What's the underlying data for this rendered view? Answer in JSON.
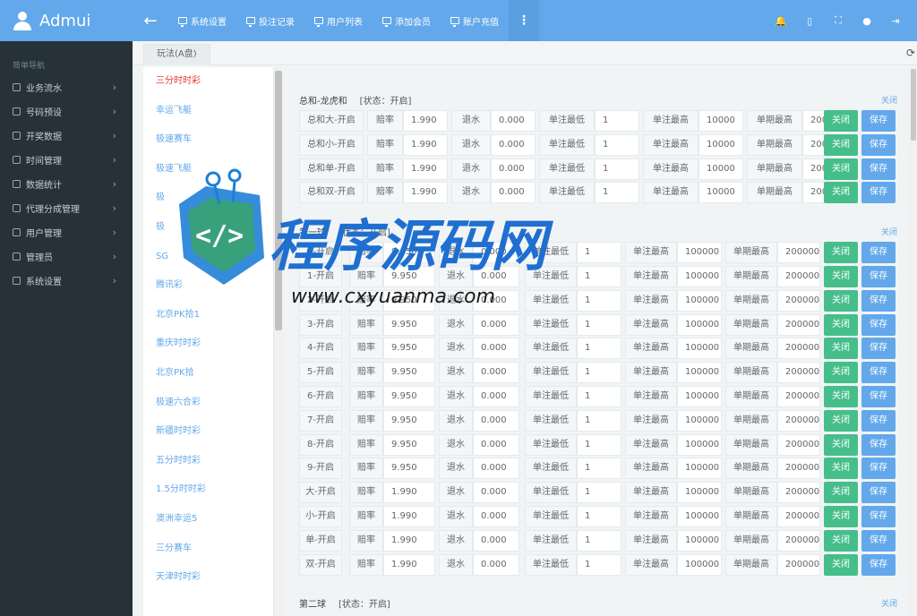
{
  "brand": {
    "name": "Admui"
  },
  "topnav": {
    "back_label": "←",
    "items": [
      {
        "label": "系统设置"
      },
      {
        "label": "投注记录"
      },
      {
        "label": "用户列表"
      },
      {
        "label": "添加会员"
      },
      {
        "label": "账户充值"
      }
    ],
    "more_label": "⋮",
    "right_icons": [
      "bell-icon",
      "document-icon",
      "fullscreen-icon",
      "user-icon",
      "logout-icon"
    ]
  },
  "sidebar": {
    "title": "简单导航",
    "items": [
      {
        "label": "业务流水"
      },
      {
        "label": "号码预设"
      },
      {
        "label": "开奖数据"
      },
      {
        "label": "时间管理"
      },
      {
        "label": "数据统计"
      },
      {
        "label": "代理分成管理"
      },
      {
        "label": "用户管理"
      },
      {
        "label": "管理员"
      },
      {
        "label": "系统设置"
      }
    ]
  },
  "tabs": {
    "active": "玩法(A盘)"
  },
  "games": [
    {
      "label": "三分时时彩",
      "active": true
    },
    {
      "label": "幸运飞艇"
    },
    {
      "label": "极速赛车"
    },
    {
      "label": "极速飞艇"
    },
    {
      "label": "极"
    },
    {
      "label": "极"
    },
    {
      "label": "SG"
    },
    {
      "label": "腾讯彩"
    },
    {
      "label": "北京PK拾1"
    },
    {
      "label": "重庆时时彩"
    },
    {
      "label": "北京PK拾"
    },
    {
      "label": "极速六合彩"
    },
    {
      "label": "新疆时时彩"
    },
    {
      "label": "五分时时彩"
    },
    {
      "label": "1.5分时时彩"
    },
    {
      "label": "澳洲幸运5"
    },
    {
      "label": "三分赛车"
    },
    {
      "label": "天津时时彩"
    }
  ],
  "field_labels": {
    "odds": "赔率",
    "rebate": "退水",
    "min_bet": "单注最低",
    "max_bet": "单注最高",
    "period_max": "单期最高",
    "close_btn": "关闭",
    "save_btn": "保存"
  },
  "sections": [
    {
      "name": "总和-龙虎和",
      "status": "[状态：开启]",
      "close_link": "关闭",
      "rows": [
        {
          "label": "总和大-开启",
          "odds": "1.990",
          "rebate": "0.000",
          "min": "1",
          "max": "10000",
          "period": "20000"
        },
        {
          "label": "总和小-开启",
          "odds": "1.990",
          "rebate": "0.000",
          "min": "1",
          "max": "10000",
          "period": "20000"
        },
        {
          "label": "总和单-开启",
          "odds": "1.990",
          "rebate": "0.000",
          "min": "1",
          "max": "10000",
          "period": "20000"
        },
        {
          "label": "总和双-开启",
          "odds": "1.990",
          "rebate": "0.000",
          "min": "1",
          "max": "10000",
          "period": "20000"
        }
      ]
    },
    {
      "name": "第一球",
      "status": "[状态：开启]",
      "close_link": "关闭",
      "rows": [
        {
          "label": "0-开启",
          "odds": "9.950",
          "rebate": "0.000",
          "min": "1",
          "max": "100000",
          "period": "200000"
        },
        {
          "label": "1-开启",
          "odds": "9.950",
          "rebate": "0.000",
          "min": "1",
          "max": "100000",
          "period": "200000"
        },
        {
          "label": "2-开启",
          "odds": "9.950",
          "rebate": "0.000",
          "min": "1",
          "max": "100000",
          "period": "200000"
        },
        {
          "label": "3-开启",
          "odds": "9.950",
          "rebate": "0.000",
          "min": "1",
          "max": "100000",
          "period": "200000"
        },
        {
          "label": "4-开启",
          "odds": "9.950",
          "rebate": "0.000",
          "min": "1",
          "max": "100000",
          "period": "200000"
        },
        {
          "label": "5-开启",
          "odds": "9.950",
          "rebate": "0.000",
          "min": "1",
          "max": "100000",
          "period": "200000"
        },
        {
          "label": "6-开启",
          "odds": "9.950",
          "rebate": "0.000",
          "min": "1",
          "max": "100000",
          "period": "200000"
        },
        {
          "label": "7-开启",
          "odds": "9.950",
          "rebate": "0.000",
          "min": "1",
          "max": "100000",
          "period": "200000"
        },
        {
          "label": "8-开启",
          "odds": "9.950",
          "rebate": "0.000",
          "min": "1",
          "max": "100000",
          "period": "200000"
        },
        {
          "label": "9-开启",
          "odds": "9.950",
          "rebate": "0.000",
          "min": "1",
          "max": "100000",
          "period": "200000"
        },
        {
          "label": "大-开启",
          "odds": "1.990",
          "rebate": "0.000",
          "min": "1",
          "max": "100000",
          "period": "200000"
        },
        {
          "label": "小-开启",
          "odds": "1.990",
          "rebate": "0.000",
          "min": "1",
          "max": "100000",
          "period": "200000"
        },
        {
          "label": "单-开启",
          "odds": "1.990",
          "rebate": "0.000",
          "min": "1",
          "max": "100000",
          "period": "200000"
        },
        {
          "label": "双-开启",
          "odds": "1.990",
          "rebate": "0.000",
          "min": "1",
          "max": "100000",
          "period": "200000"
        }
      ]
    },
    {
      "name": "第二球",
      "status": "[状态：开启]",
      "close_link": "关闭",
      "rows": []
    }
  ],
  "watermark": {
    "title": "程序源码网",
    "url": "www.cxyuanma.com",
    "code_glyph": "</>"
  },
  "colors": {
    "topbar": "#62a8ea",
    "sidebar": "#263238",
    "green_button": "#46be8a",
    "blue_button": "#62a8ea",
    "active_game": "#e53935"
  }
}
